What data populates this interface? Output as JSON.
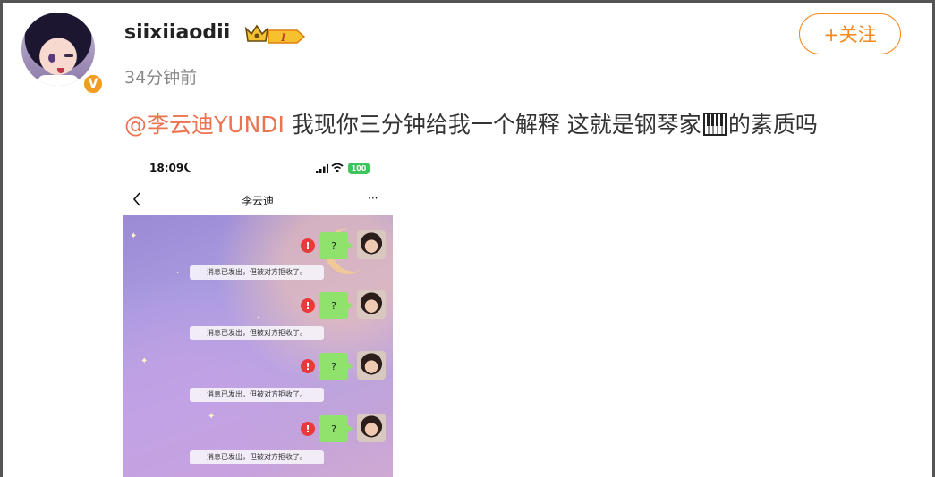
{
  "post": {
    "username": "siixiiaodii",
    "level": "I",
    "verified_badge": "V",
    "time": "34分钟前",
    "follow_label": "+关注",
    "mention": "@李云迪YUNDI",
    "text_before_icon": " 我现你三分钟给我一个解释  这就是钢琴家",
    "text_after_icon": "的素质吗",
    "accent_color": "#f4891d",
    "mention_color": "#eb7350"
  },
  "screenshot": {
    "status_time": "18:09",
    "battery": "100",
    "chat_title": "李云迪",
    "more": "···",
    "messages": [
      {
        "bubble": "?",
        "notice": "消息已发出，但被对方拒收了。"
      },
      {
        "bubble": "?",
        "notice": "消息已发出，但被对方拒收了。"
      },
      {
        "bubble": "?",
        "notice": "消息已发出，但被对方拒收了。"
      },
      {
        "bubble": "?",
        "notice": "消息已发出，但被对方拒收了。"
      }
    ]
  },
  "icons": [
    "crown-icon",
    "piano-icon",
    "moon-icon",
    "signal-icon",
    "wifi-icon",
    "back-icon",
    "error-icon"
  ]
}
